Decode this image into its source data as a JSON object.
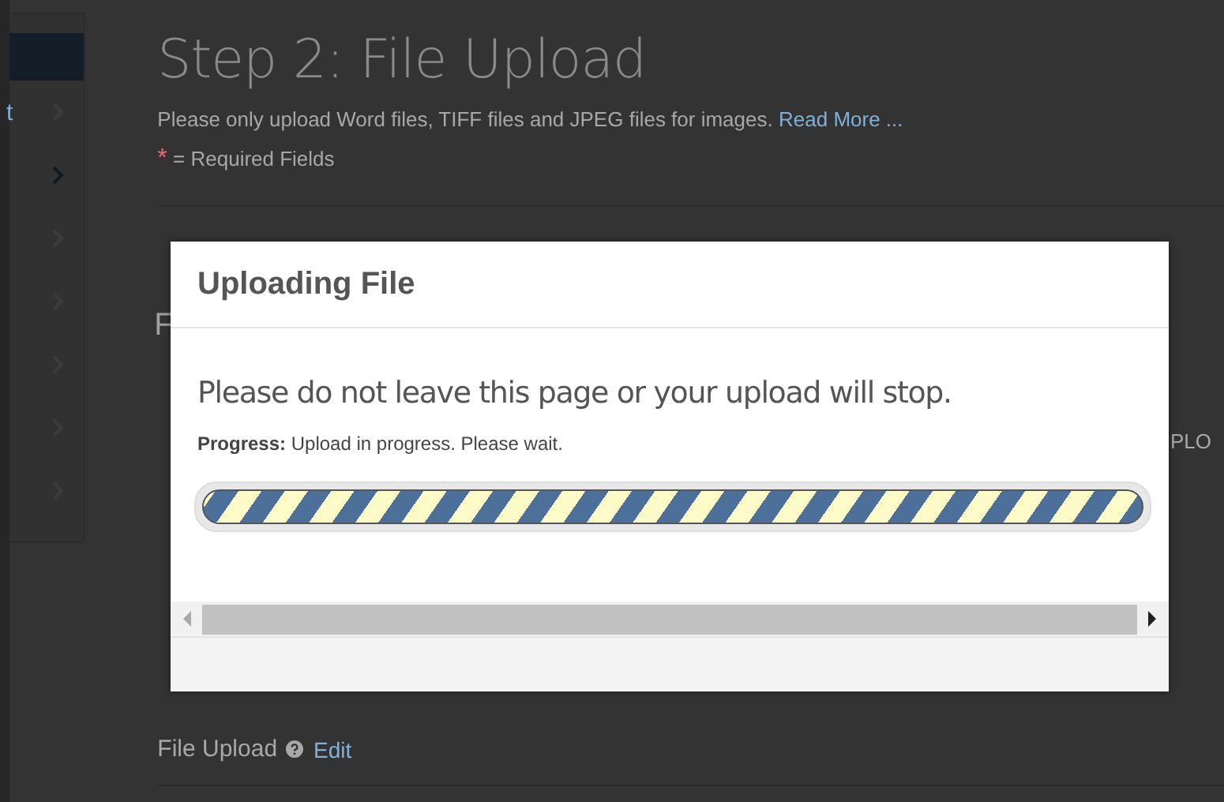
{
  "sidebar": {
    "items": [
      {
        "label": "t",
        "selected": false
      },
      {
        "selected": true
      },
      {
        "selected": false
      },
      {
        "selected": false
      },
      {
        "selected": false
      },
      {
        "selected": false
      },
      {
        "selected": false
      }
    ]
  },
  "page": {
    "title": "Step 2: File Upload",
    "intro": "Please only upload Word files, TIFF files and JPEG files for images.",
    "intro_link": "Read More ...",
    "required_mark": "*",
    "required_note": "= Required Fields",
    "section_heading_partial": "F",
    "button_partial": "PLO",
    "file_upload_label": "File Upload",
    "file_upload_link": "Edit"
  },
  "modal": {
    "title": "Uploading File",
    "warning": "Please do not leave this page or your upload will stop.",
    "progress_label": "Progress:",
    "progress_text": "Upload in progress. Please wait.",
    "level": 1
  }
}
